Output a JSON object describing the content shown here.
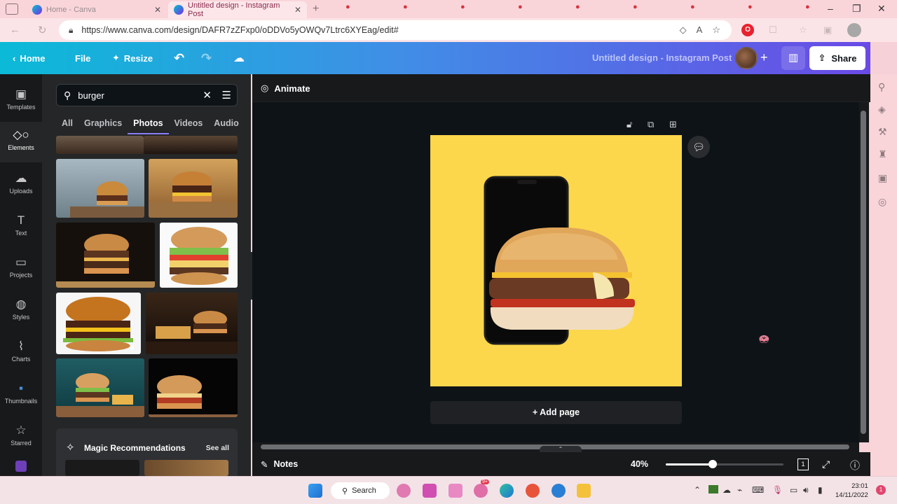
{
  "browser": {
    "tabs": [
      {
        "label": "Home - Canva"
      },
      {
        "label": "Untitled design - Instagram Post"
      }
    ],
    "url": "https://www.canva.com/design/DAFR7zZFxp0/oDDVo5yOWQv7Ltrc6XYEag/edit#"
  },
  "header": {
    "home_label": "Home",
    "file_label": "File",
    "resize_label": "Resize",
    "title": "Untitled design - Instagram Post",
    "share_label": "Share"
  },
  "rail": {
    "items": [
      {
        "label": "Templates",
        "icon": "templates-icon"
      },
      {
        "label": "Elements",
        "icon": "elements-icon"
      },
      {
        "label": "Uploads",
        "icon": "upload-icon"
      },
      {
        "label": "Text",
        "icon": "text-icon"
      },
      {
        "label": "Projects",
        "icon": "folder-icon"
      },
      {
        "label": "Styles",
        "icon": "palette-icon"
      },
      {
        "label": "Charts",
        "icon": "charts-icon"
      },
      {
        "label": "Thumbnails",
        "icon": "thumbnails-icon"
      },
      {
        "label": "Starred",
        "icon": "star-icon"
      }
    ]
  },
  "panel": {
    "search_value": "burger",
    "tabs": [
      {
        "label": "All"
      },
      {
        "label": "Graphics"
      },
      {
        "label": "Photos"
      },
      {
        "label": "Videos"
      },
      {
        "label": "Audio"
      }
    ],
    "magic_title": "Magic Recommendations",
    "see_all": "See all"
  },
  "editor": {
    "animate_label": "Animate",
    "add_page_label": "+ Add page",
    "notes_label": "Notes",
    "zoom": "40%",
    "page_count": "1",
    "canvas_color": "#fcd74c"
  },
  "taskbar": {
    "search_label": "Search",
    "time": "23:01",
    "date": "14/11/2022",
    "notification_count": "1",
    "badge": "9+"
  }
}
